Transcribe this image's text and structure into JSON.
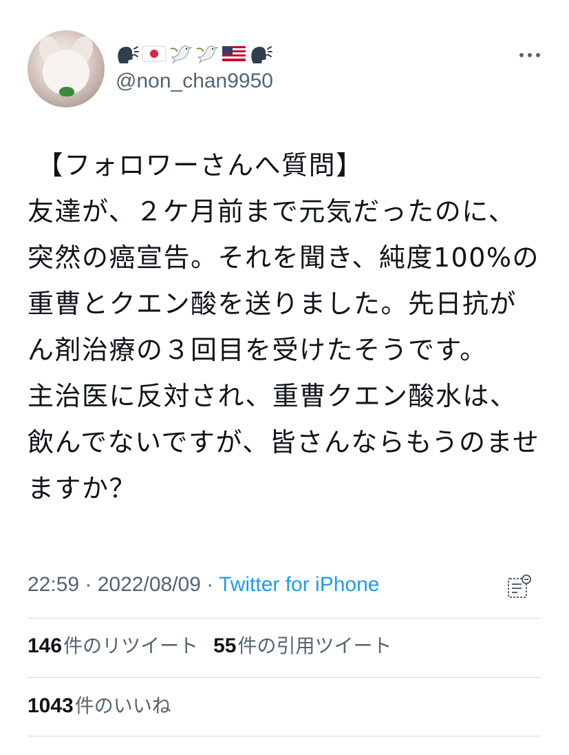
{
  "user": {
    "display_name_icons": [
      "speaking-head-icon",
      "japan-flag-icon",
      "dove-icon",
      "dove-icon",
      "us-flag-icon",
      "speaking-head-icon"
    ],
    "handle": "@non_chan9950"
  },
  "tweet": {
    "text": " 【フォロワーさんへ質問】\n友達が、２ケ月前まで元気だったのに、突然の癌宣告。それを聞き、純度100%の重曹とクエン酸を送りました。先日抗がん剤治療の３回目を受けたそうです。\n主治医に反対され、重曹クエン酸水は、飲んでないですが、皆さんならもうのませますか？",
    "time": "22:59",
    "separator": " · ",
    "date": "2022/08/09",
    "source": "Twitter for iPhone"
  },
  "stats": {
    "retweets_count": "146",
    "retweets_label": "件のリツイート",
    "quotes_count": "55",
    "quotes_label": "件の引用ツイート",
    "likes_count": "1043",
    "likes_label": "件のいいね"
  },
  "colors": {
    "text": "#0f1419",
    "secondary": "#536471",
    "link": "#1d9bf0",
    "divider": "#cfd9de"
  }
}
